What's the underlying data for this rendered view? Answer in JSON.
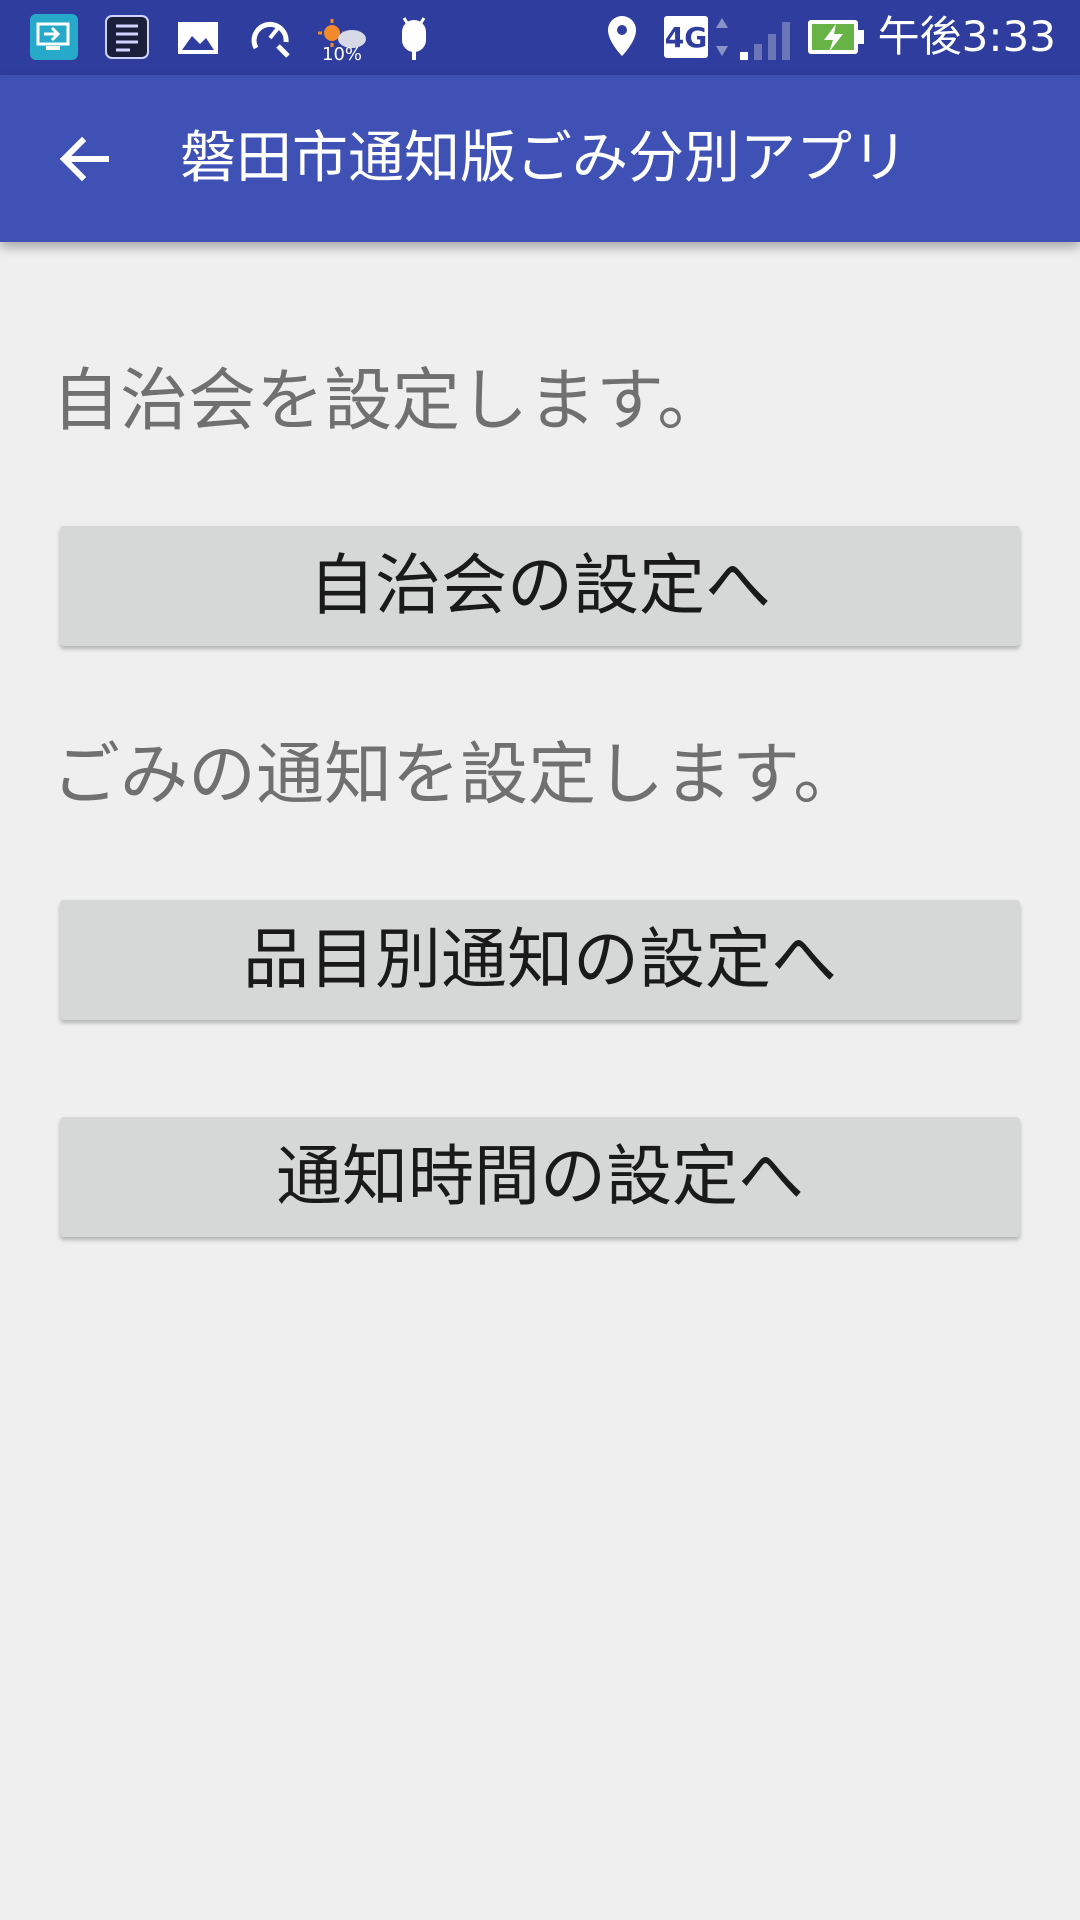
{
  "status_bar": {
    "time": "午後3:33",
    "weather_percent": "10%",
    "network": "4G",
    "icons": [
      "screen-mirror-icon",
      "task-list-icon",
      "image-icon",
      "speed-tool-icon",
      "weather-icon",
      "android-icon",
      "location-icon",
      "network-4g-icon",
      "signal-icon",
      "battery-charging-icon"
    ]
  },
  "app_bar": {
    "title": "磐田市通知版ごみ分別アプリ",
    "back_icon": "arrow-back-icon"
  },
  "main": {
    "section1_text": "自治会を設定します。",
    "button_neighborhood": "自治会の設定へ",
    "section2_text": "ごみの通知を設定します。",
    "button_item_notification": "品目別通知の設定へ",
    "button_notification_time": "通知時間の設定へ"
  },
  "colors": {
    "status_bar": "#2f3e9e",
    "app_bar": "#3f51b5",
    "background": "#efefef",
    "button": "#d6d7d7",
    "section_text": "#707070"
  }
}
